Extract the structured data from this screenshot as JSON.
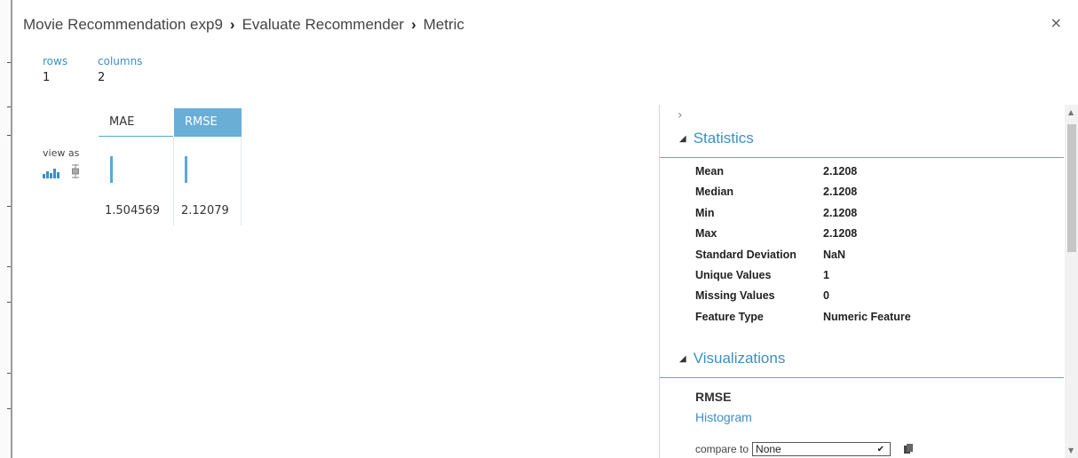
{
  "breadcrumb": {
    "items": [
      "Movie Recommendation exp9",
      "Evaluate Recommender",
      "Metric"
    ],
    "separator": "›"
  },
  "close_label": "×",
  "dims": {
    "rows_label": "rows",
    "rows_value": "1",
    "columns_label": "columns",
    "columns_value": "2"
  },
  "viewas_label": "view as",
  "table": {
    "columns": [
      {
        "name": "MAE",
        "value": "1.504569",
        "selected": false
      },
      {
        "name": "RMSE",
        "value": "2.12079",
        "selected": true
      }
    ]
  },
  "panel": {
    "expand_chevron": "›",
    "statistics_title": "Statistics",
    "stats": [
      {
        "label": "Mean",
        "value": "2.1208"
      },
      {
        "label": "Median",
        "value": "2.1208"
      },
      {
        "label": "Min",
        "value": "2.1208"
      },
      {
        "label": "Max",
        "value": "2.1208"
      },
      {
        "label": "Standard Deviation",
        "value": "NaN"
      },
      {
        "label": "Unique Values",
        "value": "1"
      },
      {
        "label": "Missing Values",
        "value": "0"
      },
      {
        "label": "Feature Type",
        "value": "Numeric Feature"
      }
    ],
    "visualizations_title": "Visualizations",
    "viz_column": "RMSE",
    "viz_link": "Histogram",
    "compare_label": "compare to",
    "compare_value": "None"
  },
  "colors": {
    "accent": "#3c8fc6",
    "selected_header": "#6aaed6"
  }
}
